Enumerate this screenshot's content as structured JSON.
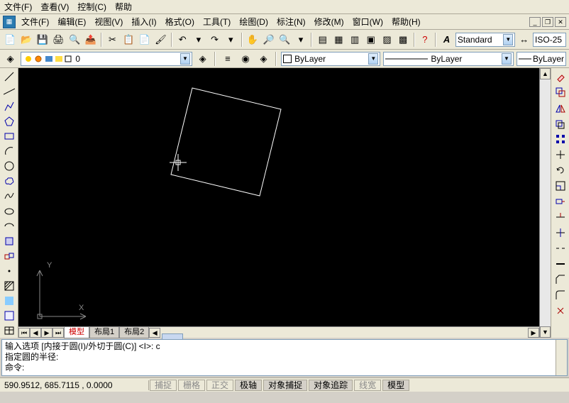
{
  "topmenu": {
    "file": "文件(F)",
    "view": "查看(V)",
    "control": "控制(C)",
    "help": "帮助"
  },
  "menu2": {
    "file": "文件(F)",
    "edit": "编辑(E)",
    "view": "视图(V)",
    "insert": "插入(I)",
    "format": "格式(O)",
    "tools": "工具(T)",
    "draw": "绘图(D)",
    "dimension": "标注(N)",
    "modify": "修改(M)",
    "window": "窗口(W)",
    "help": "帮助(H)"
  },
  "style_dd": "Standard",
  "dim_dd": "ISO-25",
  "layer_dd": "0",
  "color_dd": "ByLayer",
  "linetype_dd": "ByLayer",
  "lineweight_dd": "ByLayer",
  "tabs": {
    "model": "模型",
    "layout1": "布局1",
    "layout2": "布局2"
  },
  "cmd": {
    "l1": "输入选项 [内接于圆(I)/外切于圆(C)] <I>: c",
    "l2": "指定圆的半径:",
    "l3": "命令:"
  },
  "status": {
    "coords": "590.9512, 685.7115 , 0.0000",
    "snap": "捕捉",
    "grid": "栅格",
    "ortho": "正交",
    "polar": "极轴",
    "osnap": "对象捕捉",
    "otrack": "对象追踪",
    "lwt": "线宽",
    "model": "模型"
  },
  "axis": {
    "x": "X",
    "y": "Y"
  }
}
